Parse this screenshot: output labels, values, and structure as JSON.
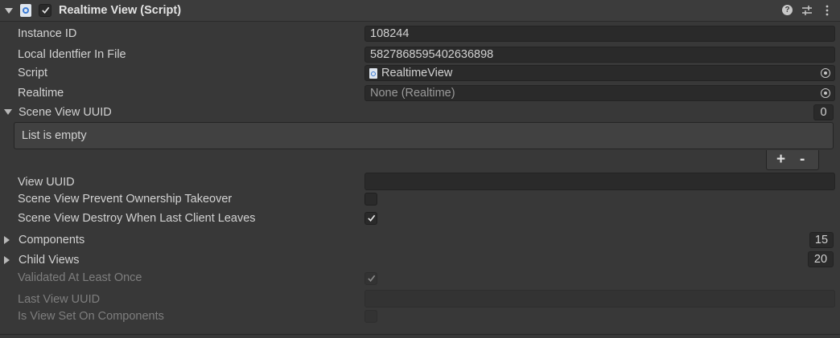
{
  "header": {
    "component_icon": "csharp-script-icon",
    "title": "Realtime View (Script)",
    "enabled": true,
    "help_icon": "help-icon",
    "preset_icon": "presets-icon",
    "menu_icon": "kebab-menu-icon"
  },
  "fields": {
    "instance_id": {
      "label": "Instance ID",
      "value": "108244"
    },
    "local_identifier": {
      "label": "Local Identfier In File",
      "value": "5827868595402636898"
    },
    "script": {
      "label": "Script",
      "value": "RealtimeView",
      "icon": "script-file-icon"
    },
    "realtime": {
      "label": "Realtime",
      "value": "None (Realtime)"
    },
    "scene_view_uuid": {
      "label": "Scene View UUID",
      "count": "0",
      "empty_text": "List is empty",
      "add_label": "+",
      "remove_label": "-"
    },
    "view_uuid": {
      "label": "View UUID",
      "value": ""
    },
    "prevent_takeover": {
      "label": "Scene View Prevent Ownership Takeover",
      "checked": false
    },
    "destroy_when_last": {
      "label": "Scene View Destroy When Last Client Leaves",
      "checked": true
    },
    "components": {
      "label": "Components",
      "count": "15"
    },
    "child_views": {
      "label": "Child Views",
      "count": "20"
    },
    "validated": {
      "label": "Validated At Least Once",
      "checked": true,
      "disabled": true
    },
    "last_view_uuid": {
      "label": "Last View UUID",
      "value": "",
      "disabled": true
    },
    "is_view_set": {
      "label": "Is View Set On Components",
      "checked": false,
      "disabled": true
    }
  },
  "colors": {
    "background": "#383838",
    "field": "#2a2a2a",
    "text": "#d2d2d2",
    "disabled_text": "#7e7e7e"
  }
}
